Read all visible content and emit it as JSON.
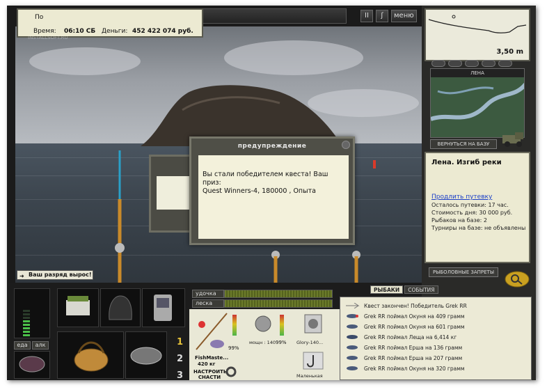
{
  "hud": {
    "status_text": "По",
    "time_label": "Время:",
    "time_value": "06:10 СБ",
    "money_label": "Деньги:",
    "money_value": "452 422 074 руб.",
    "watermark": "INSTALLSOFT.RU"
  },
  "top_controls": {
    "pause": "II",
    "rod": "ʃ",
    "menu": "меню"
  },
  "depth": {
    "value": "3,50 m"
  },
  "map": {
    "title": "ЛЕНА",
    "back_label": "ВЕРНУТЬСЯ НА БАЗУ"
  },
  "location": {
    "title": "Лена. Изгиб реки",
    "extend_link": "Продлить путевку",
    "lines": [
      "Осталось путевки: 17 час.",
      "Стоимость дня: 30 000 руб.",
      "Рыбаков на базе: 2",
      "Турниры на базе: не объявлены"
    ],
    "bans_label": "РЫБОЛОВНЫЕ ЗАПРЕТЫ"
  },
  "rank_message": "Ваш разряд вырос!",
  "dialog": {
    "title": "предупреждение",
    "body_line1": "Вы стали победителем квеста! Ваш приз:",
    "body_line2": "Quest Winners-4, 180000 , Опыта"
  },
  "dialog_back": {
    "label": "П"
  },
  "bottom": {
    "food_tab": "еда",
    "alc_tab": "алк",
    "rod_label": "удочка",
    "line_label": "леска",
    "slots": [
      "1",
      "2",
      "3"
    ]
  },
  "rig": {
    "rod_name": "FishMaste...",
    "rod_weight": "420 кг",
    "rod_pct": "99%",
    "reel_caption": "мощн : 140",
    "reel_pct": "99%",
    "line_caption": "Glory-140...",
    "hook_caption": "Маленькая",
    "setup_button": "НАСТРОИТЬ СНАСТИ"
  },
  "log": {
    "tabs": [
      "РЫБАКИ",
      "СОБЫТИЯ"
    ],
    "entries": [
      "Квест закончен! Победитель Grek RR",
      "Grek RR поймал Окуня на 409 грамм",
      "Grek RR поймал Окуня на 601 грамм",
      "Grek RR поймал Леща на 6,414 кг",
      "Grek RR поймал Ерша на 136 грамм",
      "Grek RR поймал Ерша на 207 грамм",
      "Grek RR поймал Окуня на 320 грамм"
    ]
  },
  "colors": {
    "panel": "#ecead2",
    "frame": "#1b1b1b",
    "accent": "#e6c23a",
    "link": "#1a3ec7"
  }
}
